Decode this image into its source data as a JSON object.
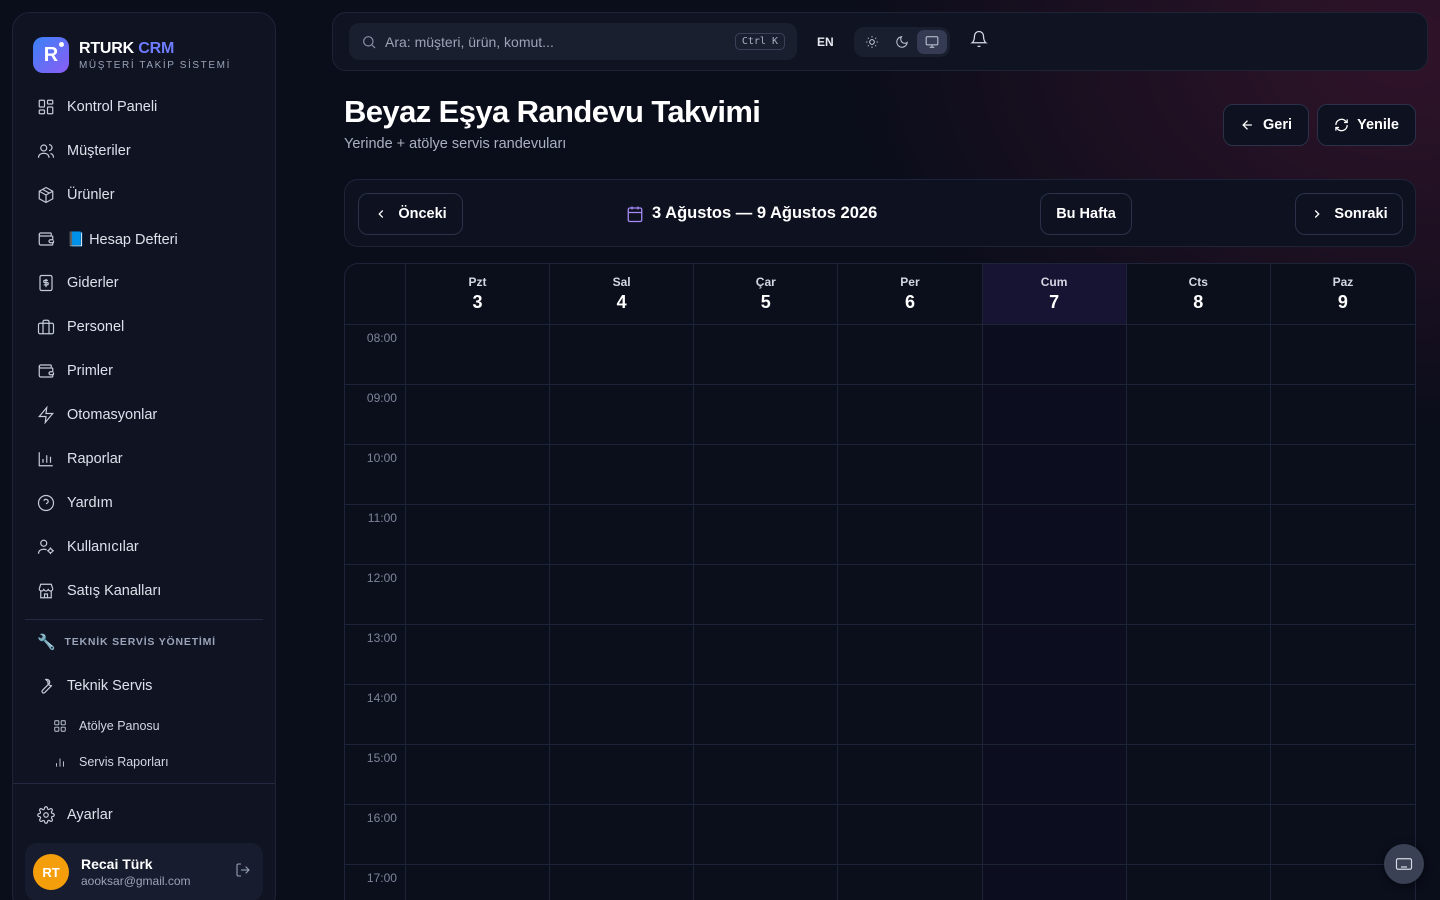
{
  "brand": {
    "name": "RTURK",
    "name_accent": "CRM",
    "subtitle": "MÜŞTERİ TAKİP SİSTEMİ",
    "logo_letter": "R"
  },
  "sidebar": {
    "items": [
      {
        "label": "Kontrol Paneli",
        "icon": "grid-icon"
      },
      {
        "label": "Müşteriler",
        "icon": "users-icon"
      },
      {
        "label": "Ürünler",
        "icon": "box-icon"
      },
      {
        "label": "📘 Hesap Defteri",
        "icon": "wallet-icon"
      },
      {
        "label": "Giderler",
        "icon": "receipt-icon"
      },
      {
        "label": "Personel",
        "icon": "briefcase-icon"
      },
      {
        "label": "Primler",
        "icon": "wallet-icon"
      },
      {
        "label": "Otomasyonlar",
        "icon": "zap-icon"
      },
      {
        "label": "Raporlar",
        "icon": "bar-chart-icon"
      },
      {
        "label": "Yardım",
        "icon": "help-circle-icon"
      },
      {
        "label": "Kullanıcılar",
        "icon": "user-cog-icon"
      },
      {
        "label": "Satış Kanalları",
        "icon": "store-icon"
      }
    ],
    "section_title": "TEKNİK SERVİS YÖNETİMİ",
    "section_item": "Teknik Servis",
    "sub_items": [
      "Atölye Panosu",
      "Servis Raporları"
    ],
    "settings_label": "Ayarlar"
  },
  "user": {
    "initials": "RT",
    "name": "Recai Türk",
    "email": "aooksar@gmail.com"
  },
  "topbar": {
    "search_placeholder": "Ara: müşteri, ürün, komut...",
    "shortcut": "Ctrl K",
    "language": "EN",
    "theme_active": "system"
  },
  "header": {
    "title": "Beyaz Eşya Randevu Takvimi",
    "subtitle": "Yerinde + atölye servis randevuları",
    "back_label": "Geri",
    "refresh_label": "Yenile"
  },
  "week_nav": {
    "prev_label": "Önceki",
    "range": "3 Ağustos — 9 Ağustos 2026",
    "today_label": "Bu Hafta",
    "next_label": "Sonraki"
  },
  "calendar": {
    "days": [
      {
        "name": "Pzt",
        "num": "3"
      },
      {
        "name": "Sal",
        "num": "4"
      },
      {
        "name": "Çar",
        "num": "5"
      },
      {
        "name": "Per",
        "num": "6"
      },
      {
        "name": "Cum",
        "num": "7",
        "today": true
      },
      {
        "name": "Cts",
        "num": "8"
      },
      {
        "name": "Paz",
        "num": "9"
      }
    ],
    "hours": [
      "08:00",
      "09:00",
      "10:00",
      "11:00",
      "12:00",
      "13:00",
      "14:00",
      "15:00",
      "16:00",
      "17:00"
    ]
  },
  "colors": {
    "background": "#0a0d1a",
    "accent": "#6e7cff",
    "today_column": "#161432",
    "avatar": "#f59e0b"
  }
}
